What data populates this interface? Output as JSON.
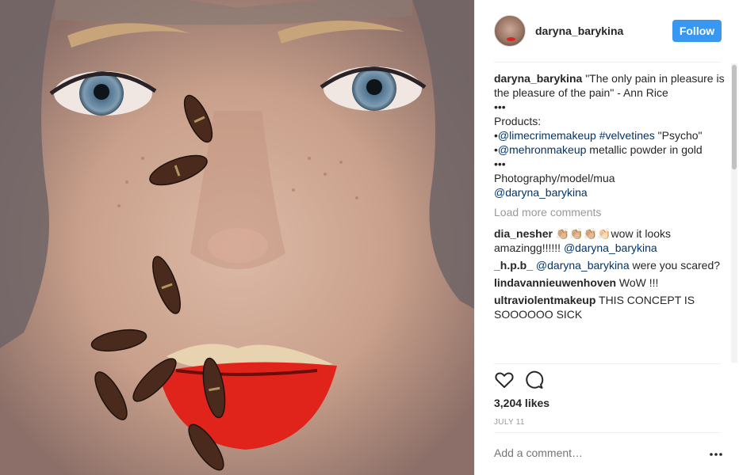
{
  "post": {
    "username": "daryna_barykina",
    "follow_label": "Follow",
    "caption": {
      "author": "daryna_barykina",
      "quote": "\"The only pain in pleasure is the pleasure of the pain\" - Ann Rice",
      "sep1": "•••",
      "products_label": "Products:",
      "bullet1": "•",
      "mention1": "@limecrimemakeup",
      "hashtag1": "#velvetines",
      "psycho": "\"Psycho\" •",
      "mention2": "@mehronmakeup",
      "metallic": " metallic powder in gold",
      "sep2": "•••",
      "credits": "Photography/model/mua",
      "mention3": "@daryna_barykina"
    },
    "load_more": "Load more comments",
    "comments": [
      {
        "author": "dia_nesher",
        "text_before": "👏🏼👏🏼👏🏼👏🏻wow it looks amazingg!!!!!! ",
        "mention": "@daryna_barykina",
        "text_after": ""
      },
      {
        "author": "_h.p.b_",
        "text_before": " ",
        "mention": "@daryna_barykina",
        "text_after": " were you scared?"
      },
      {
        "author": "lindavannieuwenhoven",
        "text_before": " WoW !!!",
        "mention": "",
        "text_after": ""
      },
      {
        "author": "ultraviolentmakeup",
        "text_before": " THIS CONCEPT IS SOOOOOO SICK",
        "mention": "",
        "text_after": ""
      }
    ],
    "likes": "3,204 likes",
    "date": "JULY 11",
    "add_comment_placeholder": "Add a comment…"
  },
  "icons": {
    "like": "heart-outline-icon",
    "comment": "speech-bubble-icon",
    "more": "more-options-icon"
  },
  "colors": {
    "follow_button": "#3897f0",
    "mention": "#003569",
    "muted": "#999999",
    "lips": "#e0231b"
  }
}
